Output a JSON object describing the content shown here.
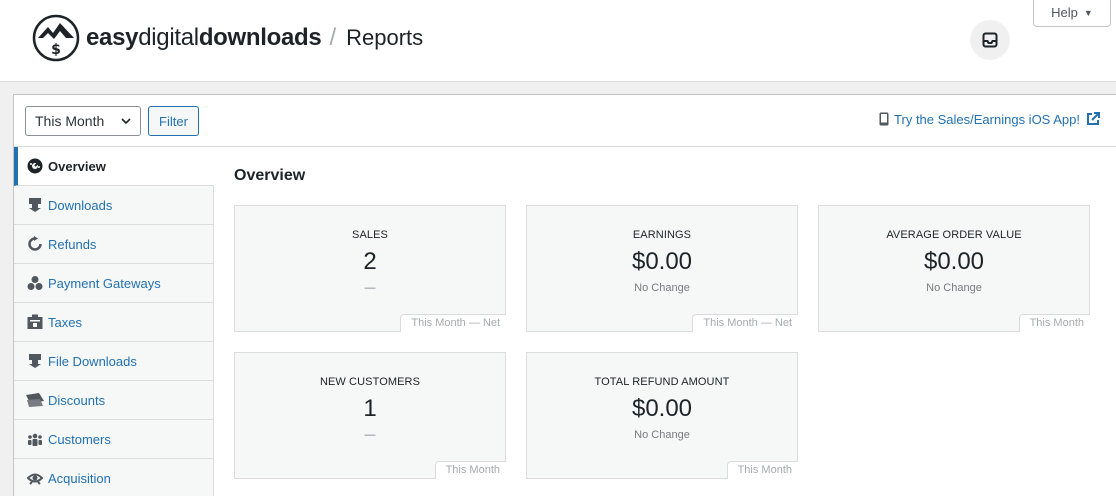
{
  "header": {
    "brand_bold": "easy",
    "brand_mid": "digital",
    "brand_end": "downloads",
    "separator": "/",
    "page": "Reports",
    "help_label": "Help"
  },
  "toolbar": {
    "date_range": "This Month",
    "filter_label": "Filter",
    "ios_link": "Try the Sales/Earnings iOS App!"
  },
  "nav": {
    "items": [
      {
        "label": "Overview",
        "icon": "dashboard-icon"
      },
      {
        "label": "Downloads",
        "icon": "download-icon"
      },
      {
        "label": "Refunds",
        "icon": "refund-icon"
      },
      {
        "label": "Payment Gateways",
        "icon": "gateways-icon"
      },
      {
        "label": "Taxes",
        "icon": "taxes-icon"
      },
      {
        "label": "File Downloads",
        "icon": "download-icon"
      },
      {
        "label": "Discounts",
        "icon": "tickets-icon"
      },
      {
        "label": "Customers",
        "icon": "groups-icon"
      },
      {
        "label": "Acquisition",
        "icon": "acquisition-icon"
      }
    ]
  },
  "main": {
    "title": "Overview",
    "tiles": [
      {
        "label": "SALES",
        "value": "2",
        "change": "—",
        "range": "This Month — Net"
      },
      {
        "label": "EARNINGS",
        "value": "$0.00",
        "change": "No Change",
        "range": "This Month — Net"
      },
      {
        "label": "AVERAGE ORDER VALUE",
        "value": "$0.00",
        "change": "No Change",
        "range": "This Month"
      },
      {
        "label": "NEW CUSTOMERS",
        "value": "1",
        "change": "—",
        "range": "This Month"
      },
      {
        "label": "TOTAL REFUND AMOUNT",
        "value": "$0.00",
        "change": "No Change",
        "range": "This Month"
      }
    ]
  },
  "colors": {
    "accent": "#2271b1",
    "text": "#1d2327",
    "tile_bg": "#f6f7f7"
  }
}
